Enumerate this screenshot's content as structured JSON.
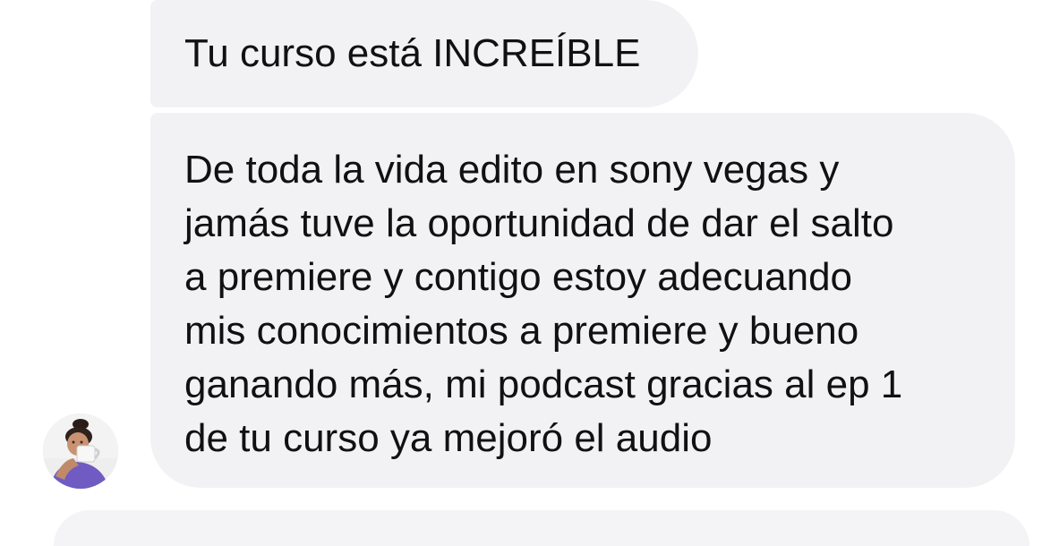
{
  "conversation": {
    "messages": [
      {
        "text": "Tu curso está INCREÍBLE"
      },
      {
        "lines": [
          "De toda la vida edito en sony vegas y",
          "jamás tuve la oportunidad de dar el salto",
          "a premiere y contigo estoy adecuando",
          "mis conocimientos a premiere y bueno",
          "ganando más, mi podcast gracias al ep 1",
          "de tu curso ya mejoró el audio"
        ]
      }
    ],
    "sender_avatar": {
      "icon": "user-avatar-photo"
    }
  },
  "colors": {
    "bubble_background": "#f2f2f5",
    "text": "#111111",
    "page_background": "#ffffff"
  }
}
